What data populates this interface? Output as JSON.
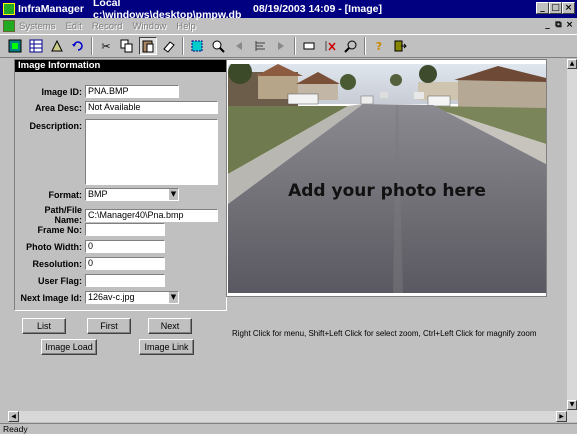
{
  "window": {
    "app_name": "InfraManager",
    "path": "Local c:\\windows\\desktop\\pmpw.db",
    "datetime": "08/19/2003 14:09 - [Image]"
  },
  "menu": [
    "Systems",
    "Edit",
    "Record",
    "Window",
    "Help"
  ],
  "toolbar": {
    "icons": [
      "map-icon",
      "grid-icon",
      "draw-icon",
      "undo-icon",
      "cut-icon",
      "copy-icon",
      "paste-icon",
      "eraser-icon",
      "select-icon",
      "zoom-all-icon",
      "prev-icon",
      "align-icon",
      "next-icon",
      "flag-icon",
      "clear-icon",
      "find-icon",
      "help-icon",
      "exit-icon"
    ]
  },
  "image_info": {
    "header": "Image Information",
    "fields": {
      "image_id": {
        "label": "Image ID:",
        "value": "PNA.BMP"
      },
      "area_desc": {
        "label": "Area Desc:",
        "value": "Not Available"
      },
      "description": {
        "label": "Description:",
        "value": ""
      },
      "format": {
        "label": "Format:",
        "value": "BMP"
      },
      "path": {
        "label": "Path/File Name:",
        "value": "C:\\Manager40\\Pna.bmp"
      },
      "frame_no": {
        "label": "Frame No:",
        "value": ""
      },
      "photo_width": {
        "label": "Photo Width:",
        "value": "0"
      },
      "resolution": {
        "label": "Resolution:",
        "value": "0"
      },
      "user_flag": {
        "label": "User Flag:",
        "value": ""
      },
      "next_image": {
        "label": "Next Image Id:",
        "value": "126av-c.jpg"
      }
    }
  },
  "buttons": {
    "list": "List",
    "first": "First",
    "next": "Next",
    "image_load": "Image Load",
    "image_link": "Image Link"
  },
  "photo": {
    "caption": "Add your photo here"
  },
  "hint": "Right Click for menu, Shift+Left Click for select zoom, Ctrl+Left Click for magnify zoom",
  "status": "Ready",
  "colors": {
    "titlebar": "#000080",
    "face": "#c0c0c0",
    "header": "#000000"
  }
}
